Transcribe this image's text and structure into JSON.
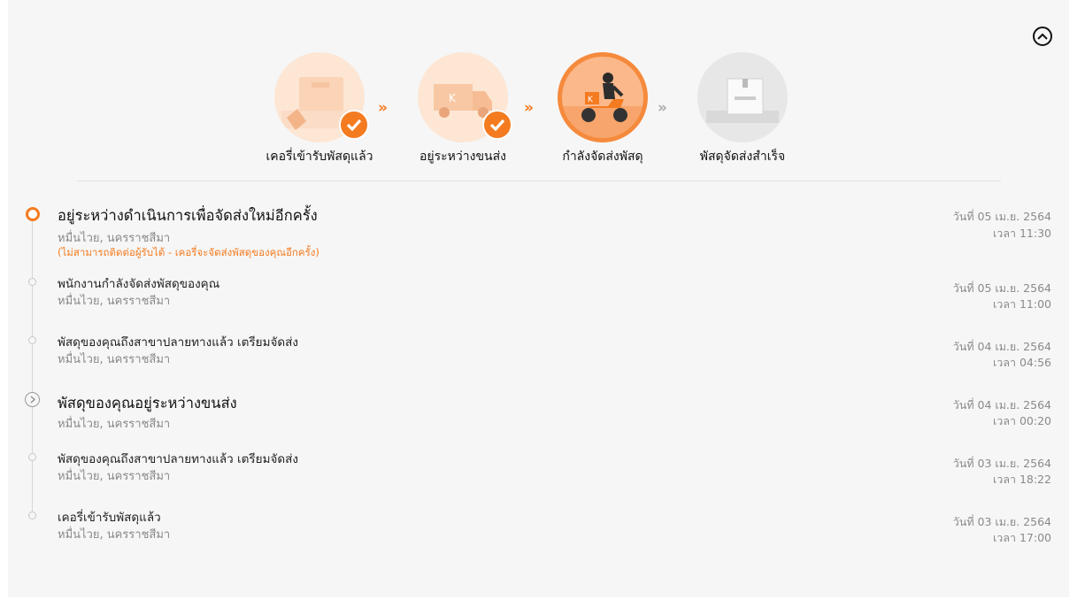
{
  "progress": {
    "steps": [
      {
        "label": "เคอรี่เข้ารับพัสดุแล้ว",
        "state": "done",
        "icon": "parcel-pickup-icon"
      },
      {
        "label": "อยู่ระหว่างขนส่ง",
        "state": "done",
        "icon": "truck-icon"
      },
      {
        "label": "กำลังจัดส่งพัสดุ",
        "state": "active",
        "icon": "scooter-courier-icon"
      },
      {
        "label": "พัสดุจัดส่งสำเร็จ",
        "state": "pending",
        "icon": "delivered-box-icon"
      }
    ],
    "check_icon": "check-icon",
    "arrow_icon": "double-chevron-right-icon"
  },
  "collapse_icon": "chevron-up-circle-icon",
  "colors": {
    "accent": "#f47b20",
    "muted_text": "#8a8a8a",
    "background": "#f6f6f6"
  },
  "timeline": [
    {
      "title": "อยู่ระหว่างดำเนินการเพื่อจัดส่งใหม่อีกครั้ง",
      "location": "หมื่นไวย, นครราชสีมา",
      "note": "(ไม่สามารถติดต่อผู้รับได้ - เคอรี่จะจัดส่งพัสดุของคุณอีกครั้ง)",
      "date": "วันที่ 05 เม.ย. 2564",
      "time": "เวลา 11:30",
      "marker": "current"
    },
    {
      "title": "พนักงานกำลังจัดส่งพัสดุของคุณ",
      "location": "หมื่นไวย, นครราชสีมา",
      "date": "วันที่ 05 เม.ย. 2564",
      "time": "เวลา 11:00",
      "marker": "dot"
    },
    {
      "title": "พัสดุของคุณถึงสาขาปลายทางแล้ว เตรียมจัดส่ง",
      "location": "หมื่นไวย, นครราชสีมา",
      "date": "วันที่ 04 เม.ย. 2564",
      "time": "เวลา 04:56",
      "marker": "dot"
    },
    {
      "title": "พัสดุของคุณอยู่ระหว่างขนส่ง",
      "location": "หมื่นไวย, นครราชสีมา",
      "date": "วันที่ 04 เม.ย. 2564",
      "time": "เวลา 00:20",
      "marker": "transit"
    },
    {
      "title": "พัสดุของคุณถึงสาขาปลายทางแล้ว เตรียมจัดส่ง",
      "location": "หมื่นไวย, นครราชสีมา",
      "date": "วันที่ 03 เม.ย. 2564",
      "time": "เวลา 18:22",
      "marker": "dot"
    },
    {
      "title": "เคอรี่เข้ารับพัสดุแล้ว",
      "location": "หมื่นไวย, นครราชสีมา",
      "date": "วันที่ 03 เม.ย. 2564",
      "time": "เวลา 17:00",
      "marker": "dot"
    }
  ]
}
